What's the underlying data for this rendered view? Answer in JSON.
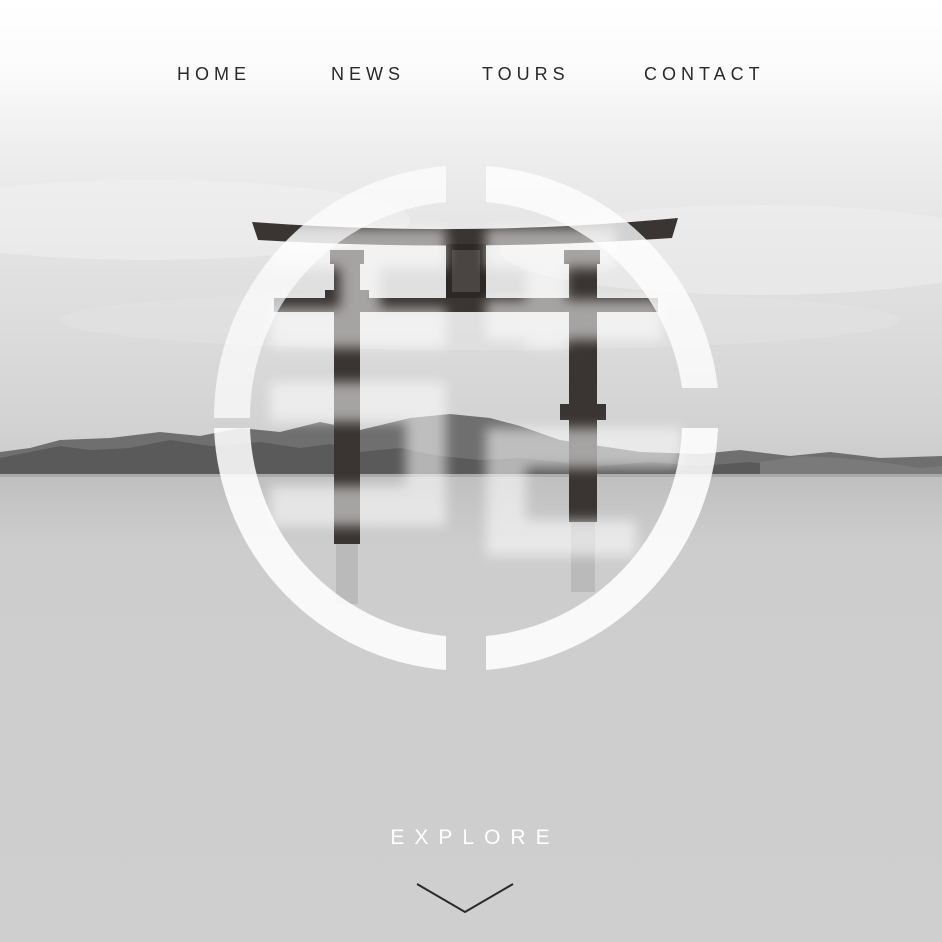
{
  "nav": {
    "items": [
      {
        "label": "HOME"
      },
      {
        "label": "NEWS"
      },
      {
        "label": "TOURS"
      },
      {
        "label": "CONTACT"
      }
    ]
  },
  "hero": {
    "background": "torii gate standing in calm lake, black and white photo",
    "logo_icon": "circular-seal-logo"
  },
  "cta": {
    "label": "EXPLORE",
    "icon": "chevron-down-icon"
  },
  "colors": {
    "nav_text": "#2a2a2a",
    "cta_text": "#ffffff",
    "logo_fill": "#ffffff"
  }
}
